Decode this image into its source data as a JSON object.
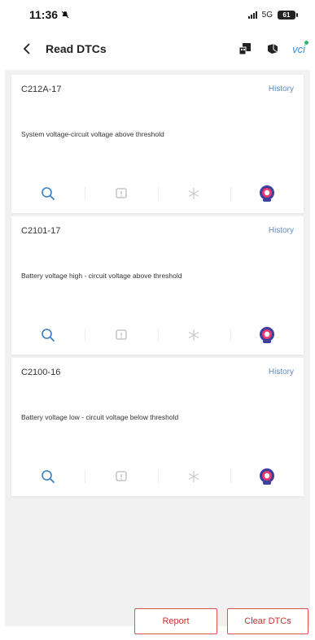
{
  "status_bar": {
    "time": "11:36",
    "network": "5G",
    "battery": "61"
  },
  "nav": {
    "title": "Read DTCs",
    "vci_label": "vci"
  },
  "dtcs": [
    {
      "code": "C212A-17",
      "history_label": "History",
      "description": "System voltage-circuit voltage above threshold"
    },
    {
      "code": "C2101-17",
      "history_label": "History",
      "description": "Battery voltage high - circuit voltage above threshold"
    },
    {
      "code": "C2100-16",
      "history_label": "History",
      "description": "Battery voltage low - circuit voltage below threshold"
    }
  ],
  "actions": {
    "report_label": "Report",
    "clear_label": "Clear DTCs"
  },
  "colors": {
    "accent_blue": "#3a7fc1",
    "button_red": "#d9534f",
    "content_bg": "#f1f1f2"
  },
  "icons": {
    "dtc_actions": [
      "search-icon",
      "info-doc-icon",
      "freeze-frame-icon",
      "ai-assistant-icon"
    ]
  }
}
